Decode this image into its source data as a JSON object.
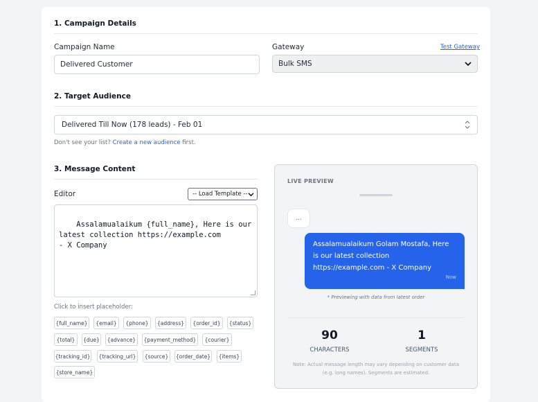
{
  "campaign": {
    "section_title": "1. Campaign Details",
    "name_label": "Campaign Name",
    "name_value": "Delivered Customer",
    "gateway_label": "Gateway",
    "test_gateway_link": "Test Gateway",
    "gateway_value": "Bulk SMS"
  },
  "audience": {
    "section_title": "2. Target Audience",
    "selected": "Delivered Till Now (178 leads) - Feb 01",
    "hint_prefix": "Don't see your list?",
    "hint_link": "Create a new audience",
    "hint_suffix": "first."
  },
  "message": {
    "section_title": "3. Message Content",
    "editor_label": "Editor",
    "template_select": "-- Load Template --",
    "editor_text": "Assalamualaikum {full_name}, Here is our\nlatest collection https://example.com\n- X Company",
    "placeholder_hint": "Click to insert placeholder:",
    "placeholders": [
      "{full_name}",
      "{email}",
      "{phone}",
      "{address}",
      "{order_id}",
      "{status}",
      "{total}",
      "{due}",
      "{advance}",
      "{payment_method}",
      "{courier}",
      "{tracking_id}",
      "{tracking_url}",
      "{source}",
      "{order_date}",
      "{items}",
      "{store_name}"
    ]
  },
  "preview": {
    "title": "LIVE PREVIEW",
    "typing": "...",
    "message": "Assalamualaikum Golam Mostafa, Here is our latest collection https://example.com - X Company",
    "time": "Now",
    "note": "* Previewing with data from latest order",
    "characters_value": "90",
    "characters_label": "CHARACTERS",
    "segments_value": "1",
    "segments_label": "SEGMENTS",
    "disclaimer": "Note: Actual message length may vary depending on customer data (e.g. long names). Segments are estimated."
  },
  "colors": {
    "accent": "#2563eb",
    "background": "#f3f4f6"
  }
}
